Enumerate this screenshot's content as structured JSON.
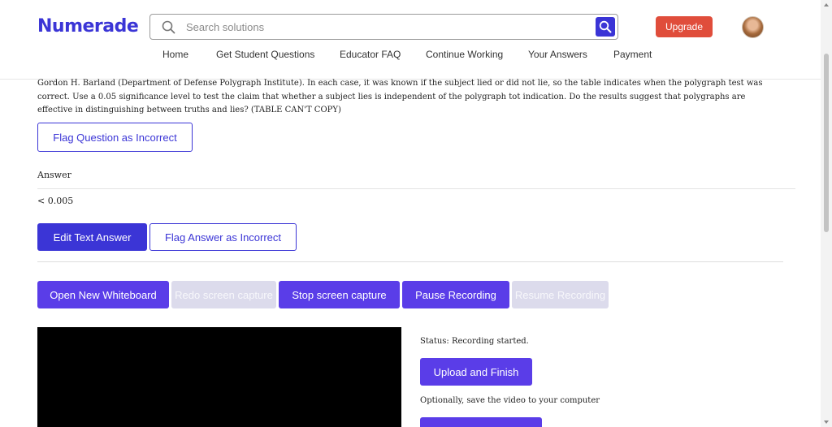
{
  "brand": {
    "logo_text": "Numerade",
    "color": "#3b35d6"
  },
  "search": {
    "placeholder": "Search solutions",
    "value": ""
  },
  "header": {
    "upgrade_label": "Upgrade"
  },
  "nav": {
    "items": [
      "Home",
      "Get Student Questions",
      "Educator FAQ",
      "Continue Working",
      "Your Answers",
      "Payment"
    ]
  },
  "question": {
    "text": "Gordon H. Barland (Department of Defense Polygraph Institute). In each case, it was known if the subject lied or did not lie, so the table indicates when the polygraph test was correct. Use a 0.05 significance level to test the claim that whether a subject lies is independent of the polygraph tot indication. Do the results suggest that polygraphs are effective in distinguishing between truths and lies? (TABLE CAN'T COPY)",
    "flag_label": "Flag Question as Incorrect"
  },
  "answer": {
    "label": "Answer",
    "value": "< 0.005",
    "edit_label": "Edit Text Answer",
    "flag_label": "Flag Answer as Incorrect"
  },
  "recording": {
    "open_whiteboard": "Open New Whiteboard",
    "redo_capture": "Redo screen capture",
    "stop_capture": "Stop screen capture",
    "pause_recording": "Pause Recording",
    "resume_recording": "Resume Recording",
    "status": "Status: Recording started.",
    "upload_finish": "Upload and Finish",
    "optional_text": "Optionally, save the video to your computer"
  },
  "colors": {
    "primary": "#3b35d6",
    "upgrade": "#e04d3b",
    "disabled": "#dcdbec"
  }
}
